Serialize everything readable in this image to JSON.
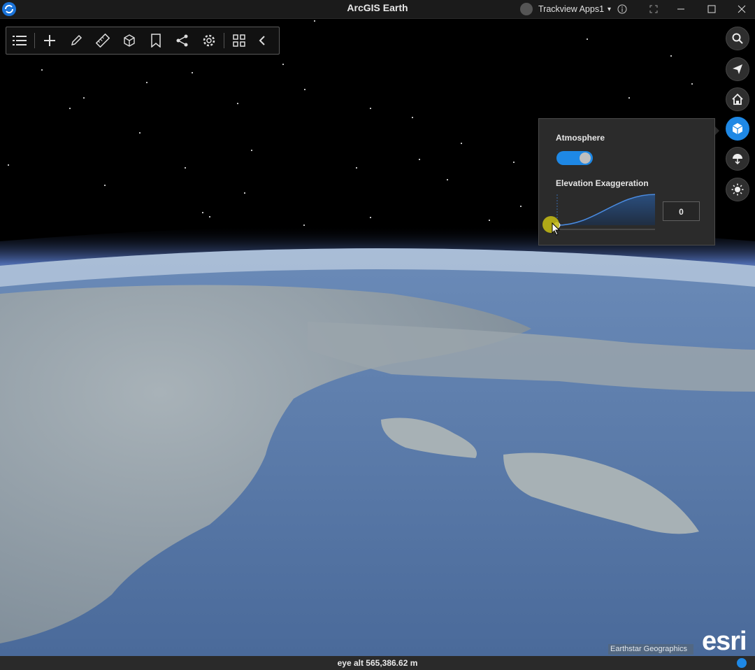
{
  "app": {
    "title": "ArcGIS Earth"
  },
  "titlebar": {
    "user_name": "Trackview Apps1",
    "user_caret": "▾"
  },
  "toolbar": {
    "buttons": [
      "layers-list",
      "add",
      "draw",
      "measure",
      "analysis",
      "bookmark",
      "share",
      "settings",
      "grid",
      "collapse"
    ]
  },
  "side_buttons": [
    "search",
    "navigate",
    "home",
    "scene-settings",
    "basemap",
    "lighting"
  ],
  "scene_panel": {
    "atmosphere_label": "Atmosphere",
    "atmosphere_on": true,
    "elevation_label": "Elevation Exaggeration",
    "elevation_value": "0"
  },
  "status": {
    "eye_alt": "eye alt 565,386.62 m"
  },
  "attribution": {
    "credit": "Earthstar Geographics",
    "brand": "esri"
  },
  "colors": {
    "accent": "#1e88e5",
    "ocean": "#4f6f9e",
    "land": "#9aa5ad"
  }
}
